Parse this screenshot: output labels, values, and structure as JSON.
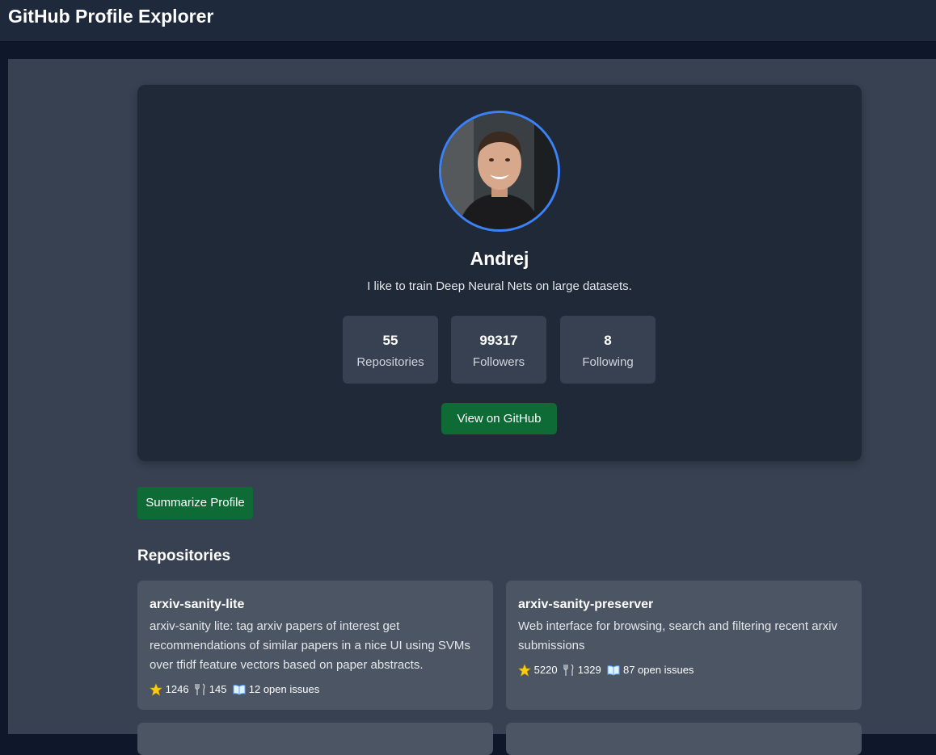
{
  "app": {
    "title": "GitHub Profile Explorer"
  },
  "profile": {
    "name": "Andrej",
    "bio": "I like to train Deep Neural Nets on large datasets.",
    "stats": [
      {
        "value": "55",
        "label": "Repositories"
      },
      {
        "value": "99317",
        "label": "Followers"
      },
      {
        "value": "8",
        "label": "Following"
      }
    ],
    "view_button": "View on GitHub"
  },
  "actions": {
    "summarize": "Summarize Profile"
  },
  "repos_section": {
    "title": "Repositories"
  },
  "repos": [
    {
      "name": "arxiv-sanity-lite",
      "description": "arxiv-sanity lite: tag arxiv papers of interest get recommendations of similar papers in a nice UI using SVMs over tfidf feature vectors based on paper abstracts.",
      "stars": "1246",
      "forks": "145",
      "issues": "12 open issues"
    },
    {
      "name": "arxiv-sanity-preserver",
      "description": "Web interface for browsing, search and filtering recent arxiv submissions",
      "stars": "5220",
      "forks": "1329",
      "issues": "87 open issues"
    }
  ],
  "colors": {
    "accent_border": "#3b82f6",
    "button_green": "#0f6b35",
    "card_bg": "#1f2937",
    "repo_bg": "#4b5563"
  }
}
